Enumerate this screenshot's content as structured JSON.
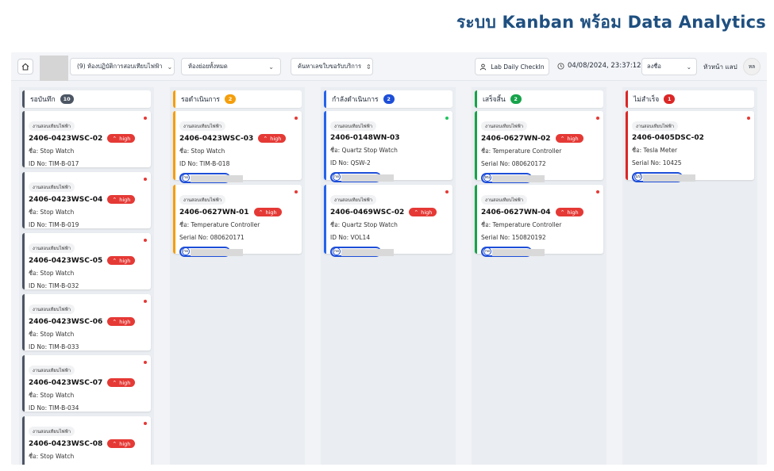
{
  "slide_title": "ระบบ Kanban พร้อม Data Analytics",
  "topbar": {
    "lab_select": "(9) ห้องปฏิบัติการสอบเทียบไฟฟ้า",
    "subunit_select": "ห้องย่อยทั้งหมด",
    "search_select": "ค้นหาเลขใบขอรับบริการ",
    "checkin_label": "Lab Daily CheckIn",
    "datetime": "04/08/2024, 23:37:12",
    "signout_label": "ลงชื่อ",
    "user_name": "หัวหน้า แลป",
    "avatar_initials": "หล"
  },
  "columns": [
    {
      "label": "รอบันทึก",
      "count": "10",
      "color": "#4b5563",
      "badge_color": "#4b5563",
      "cards": [
        {
          "tag": "งานสอบเทียบไฟฟ้า",
          "code": "2406-0423WSC-02",
          "priority": "high",
          "name": "ชื่อ: Stop Watch",
          "id": "ID No: TIM-B-017",
          "dot": "#e53935"
        },
        {
          "tag": "งานสอบเทียบไฟฟ้า",
          "code": "2406-0423WSC-04",
          "priority": "high",
          "name": "ชื่อ: Stop Watch",
          "id": "ID No: TIM-B-019",
          "dot": "#e53935"
        },
        {
          "tag": "งานสอบเทียบไฟฟ้า",
          "code": "2406-0423WSC-05",
          "priority": "high",
          "name": "ชื่อ: Stop Watch",
          "id": "ID No: TIM-B-032",
          "dot": "#e53935"
        },
        {
          "tag": "งานสอบเทียบไฟฟ้า",
          "code": "2406-0423WSC-06",
          "priority": "high",
          "name": "ชื่อ: Stop Watch",
          "id": "ID No: TIM-B-033",
          "dot": "#e53935"
        },
        {
          "tag": "งานสอบเทียบไฟฟ้า",
          "code": "2406-0423WSC-07",
          "priority": "high",
          "name": "ชื่อ: Stop Watch",
          "id": "ID No: TIM-B-034",
          "dot": "#e53935"
        },
        {
          "tag": "งานสอบเทียบไฟฟ้า",
          "code": "2406-0423WSC-08",
          "priority": "high",
          "name": "ชื่อ: Stop Watch",
          "id": "ID No: TIM-B-035",
          "dot": "#e53935"
        }
      ]
    },
    {
      "label": "รอดำเนินการ",
      "count": "2",
      "color": "#f59e0b",
      "badge_color": "#f59e0b",
      "cards": [
        {
          "tag": "งานสอบเทียบไฟฟ้า",
          "code": "2406-0423WSC-03",
          "priority": "high",
          "name": "ชื่อ: Stop Watch",
          "id": "ID No: TIM-B-018",
          "assignee": "กอ",
          "dot": "#e53935"
        },
        {
          "tag": "งานสอบเทียบไฟฟ้า",
          "code": "2406-0627WN-01",
          "priority": "high",
          "name": "ชื่อ: Temperature Controller",
          "id": "Serial No: 080620171",
          "assignee": "กอ",
          "dot": "#e53935"
        }
      ]
    },
    {
      "label": "กำลังดำเนินการ",
      "count": "2",
      "color": "#2563eb",
      "badge_color": "#1d4ed8",
      "cards": [
        {
          "tag": "งานสอบเทียบไฟฟ้า",
          "code": "2406-0148WN-03",
          "priority": "",
          "name": "ชื่อ: Quartz Stop Watch",
          "id": "ID No: QSW-2",
          "assignee": "กอ",
          "dot": "#22c55e"
        },
        {
          "tag": "งานสอบเทียบไฟฟ้า",
          "code": "2406-0469WSC-02",
          "priority": "high",
          "name": "ชื่อ: Quartz Stop Watch",
          "id": "ID No: VOL14",
          "assignee": "กอ",
          "dot": "#e53935"
        }
      ]
    },
    {
      "label": "เสร็จสิ้น",
      "count": "2",
      "color": "#16a34a",
      "badge_color": "#16a34a",
      "cards": [
        {
          "tag": "งานสอบเทียบไฟฟ้า",
          "code": "2406-0627WN-02",
          "priority": "high",
          "name": "ชื่อ: Temperature Controller",
          "id": "Serial No: 080620172",
          "assignee": "พน",
          "dot": "#e53935"
        },
        {
          "tag": "งานสอบเทียบไฟฟ้า",
          "code": "2406-0627WN-04",
          "priority": "high",
          "name": "ชื่อ: Temperature Controller",
          "id": "Serial No: 150820192",
          "assignee": "กอ",
          "dot": "#e53935"
        }
      ]
    },
    {
      "label": "ไม่สำเร็จ",
      "count": "1",
      "color": "#dc2626",
      "badge_color": "#dc2626",
      "cards": [
        {
          "tag": "งานสอบเทียบไฟฟ้า",
          "code": "2406-0405DSC-02",
          "priority": "",
          "name": "ชื่อ: Tesla Meter",
          "id": "Serial No: 10425",
          "assignee": "มป",
          "dot": "#e53935"
        }
      ]
    }
  ]
}
